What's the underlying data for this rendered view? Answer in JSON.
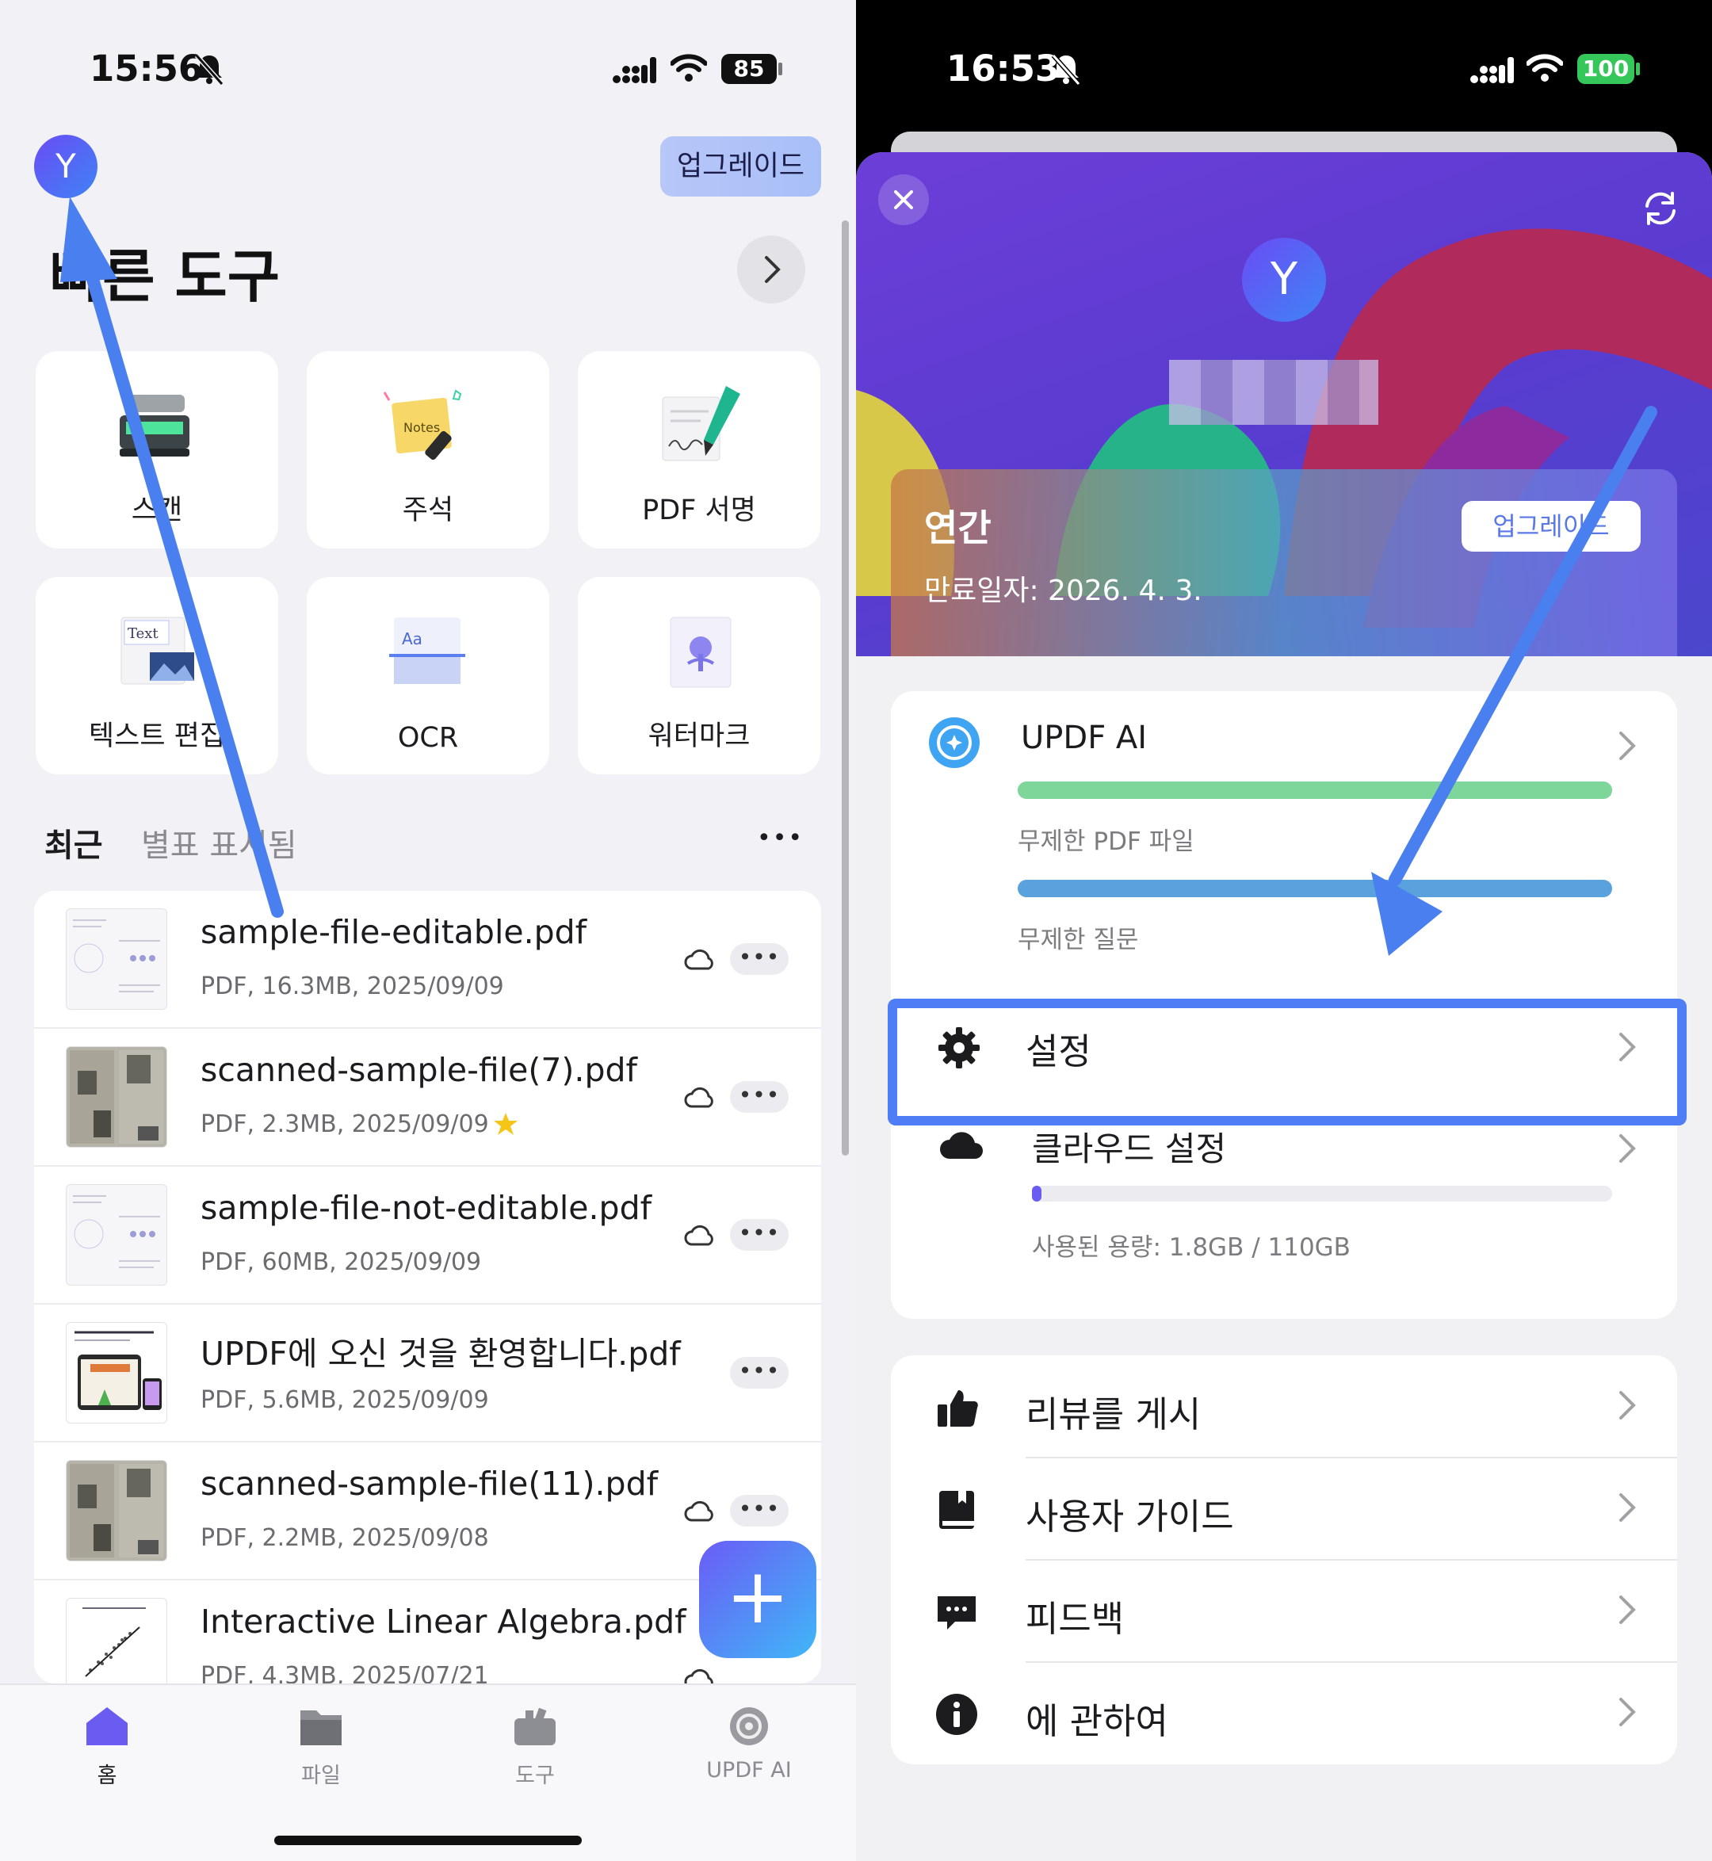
{
  "left": {
    "status": {
      "time": "15:56",
      "battery": "85"
    },
    "avatar_letter": "Y",
    "upgrade_label": "업그레이드",
    "quick_tools_title": "빠른 도구",
    "tools": [
      {
        "label": "스캔",
        "icon": "scanner-icon"
      },
      {
        "label": "주석",
        "icon": "notes-icon"
      },
      {
        "label": "PDF 서명",
        "icon": "signature-icon"
      },
      {
        "label": "텍스트 편집",
        "icon": "text-edit-icon"
      },
      {
        "label": "OCR",
        "icon": "ocr-icon"
      },
      {
        "label": "워터마크",
        "icon": "watermark-icon"
      }
    ],
    "thumb_texts": {
      "text": "Text",
      "ocr": "Aa",
      "notes": "Notes"
    },
    "recent_tabs": {
      "recent": "최근",
      "starred": "별표 표시됨"
    },
    "more_dots": "•••",
    "files": [
      {
        "name": "sample-file-editable.pdf",
        "meta": "PDF, 16.3MB, 2025/09/09",
        "cloud": true,
        "starred": false
      },
      {
        "name": "scanned-sample-file(7).pdf",
        "meta": "PDF, 2.3MB, 2025/09/09",
        "cloud": true,
        "starred": true
      },
      {
        "name": "sample-file-not-editable.pdf",
        "meta": "PDF, 60MB, 2025/09/09",
        "cloud": true,
        "starred": false
      },
      {
        "name": "UPDF에 오신 것을 환영합니다.pdf",
        "meta": "PDF, 5.6MB, 2025/09/09",
        "cloud": false,
        "starred": false
      },
      {
        "name": "scanned-sample-file(11).pdf",
        "meta": "PDF, 2.2MB, 2025/09/08",
        "cloud": true,
        "starred": false
      },
      {
        "name": "Interactive Linear Algebra.pdf",
        "meta": "PDF, 4.3MB, 2025/07/21",
        "cloud": true,
        "starred": false
      }
    ],
    "fab_label": "+",
    "tabbar": [
      {
        "label": "홈",
        "active": true
      },
      {
        "label": "파일",
        "active": false
      },
      {
        "label": "도구",
        "active": false
      },
      {
        "label": "UPDF AI",
        "active": false
      }
    ]
  },
  "right": {
    "status": {
      "time": "16:53",
      "battery": "100"
    },
    "avatar_letter": "Y",
    "plan": {
      "name": "연간",
      "expiry": "만료일자: 2026. 4. 3.",
      "upgrade_label": "업그레이드"
    },
    "ai": {
      "title": "UPDF AI",
      "files_label": "무제한 PDF 파일",
      "questions_label": "무제한 질문",
      "files_fraction": 1.0,
      "questions_fraction": 1.0
    },
    "settings_label": "설정",
    "cloud": {
      "title": "클라우드 설정",
      "usage": "사용된 용량: 1.8GB / 110GB",
      "used_fraction": 0.016
    },
    "menu": [
      {
        "label": "리뷰를 게시",
        "icon": "thumbs-up-icon"
      },
      {
        "label": "사용자 가이드",
        "icon": "book-icon"
      },
      {
        "label": "피드백",
        "icon": "chat-bubble-icon"
      },
      {
        "label": "에 관하여",
        "icon": "info-icon"
      }
    ],
    "colors": {
      "highlight": "#4f7df5",
      "green_bar": "#7ed69a",
      "blue_bar": "#5aa2dd",
      "accent_purple": "#6a5cf0"
    }
  }
}
